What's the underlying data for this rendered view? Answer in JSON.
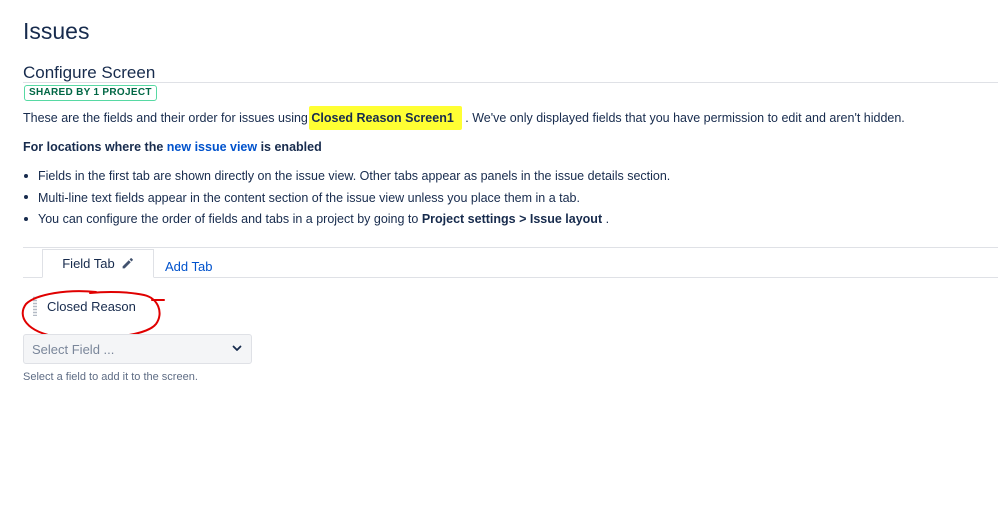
{
  "page": {
    "title": "Issues",
    "section_title": "Configure Screen",
    "shared_badge": "SHARED BY 1 PROJECT"
  },
  "intro": {
    "before": "These are the fields and their order for issues using ",
    "screen_name": "Closed Reason Screen1",
    "after": " . We've only displayed fields that you have permission to edit and aren't hidden."
  },
  "locations": {
    "prefix": "For locations where the ",
    "link": "new issue view",
    "suffix": " is enabled"
  },
  "bullets": {
    "b1": "Fields in the first tab are shown directly on the issue view. Other tabs appear as panels in the issue details section.",
    "b2": "Multi-line text fields appear in the content section of the issue view unless you place them in a tab.",
    "b3_before": "You can configure the order of fields and tabs in a project by going to ",
    "b3_settings": "Project settings",
    "b3_sep": " > ",
    "b3_layout": "Issue layout",
    "b3_after": " ."
  },
  "tabs": {
    "field_tab": "Field Tab",
    "add_tab": "Add Tab"
  },
  "fields": [
    {
      "label": "Closed Reason"
    }
  ],
  "select": {
    "placeholder": "Select Field ...",
    "help": "Select a field to add it to the screen."
  },
  "colors": {
    "highlight": "#ffff33",
    "link": "#0052cc",
    "annotation": "#e00000",
    "badge": "#006644"
  },
  "icons": {
    "edit": "pencil-icon",
    "dropdown": "chevron-down-icon",
    "drag": "drag-handle-icon"
  }
}
